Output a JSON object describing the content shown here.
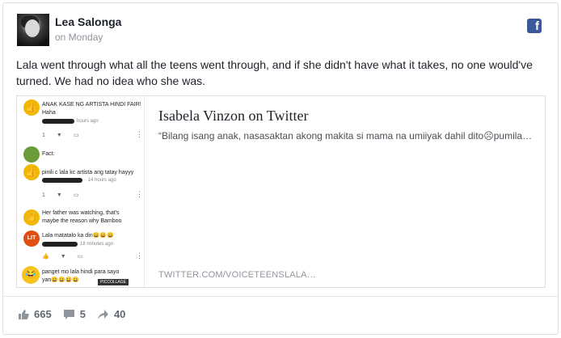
{
  "post": {
    "author": "Lea Salonga",
    "timestamp": "on Monday",
    "text": "Lala went through what all the teens went through, and if she didn't have what it takes, no one would've turned. We had no idea who she was."
  },
  "link_card": {
    "title": "Isabela Vinzon on Twitter",
    "description": "“Bilang isang anak, nasasaktan akong makita si mama na umiiyak dahil dito☹pumila…",
    "domain": "TWITTER.COM/VOICETEENSLALA…",
    "thumbnail": {
      "comments": [
        {
          "text": "ANAK KASE NG ARTISTA HINDI FAIR!",
          "sub": "Haha",
          "meta": "hours ago",
          "emoji": "thumbs-up-emoji"
        },
        {
          "text": "Fact:",
          "meta": "",
          "emoji": "green-emoji"
        },
        {
          "text": "pinili c lala kc artista ang tatay hayyy",
          "meta": "· 14 hours ago",
          "emoji": "thumbs-up-emoji"
        },
        {
          "text": "Her father was watching, that's",
          "sub": "maybe the reason why Bamboo",
          "meta": "",
          "emoji": "clap-emoji"
        },
        {
          "text": "Lala matatalo ka din😀😀😀",
          "meta": "18 minutes ago",
          "emoji": "lit-emoji",
          "emoji_text": "LIT"
        },
        {
          "text": "panget mo lala hindi para sayo",
          "sub": "yan😀😀😀😀",
          "meta": "",
          "emoji": "laughing-emoji"
        }
      ],
      "watermark": "PICCOLLAGE",
      "action_counts": [
        "1",
        "1"
      ]
    }
  },
  "stats": {
    "likes": "665",
    "comments": "5",
    "shares": "40"
  },
  "colors": {
    "facebook_blue": "#3b5998",
    "meta_gray": "#90949c"
  },
  "icons": {
    "source": "facebook-icon",
    "like": "thumbs-up-icon",
    "comment": "comment-icon",
    "share": "share-arrow-icon"
  }
}
